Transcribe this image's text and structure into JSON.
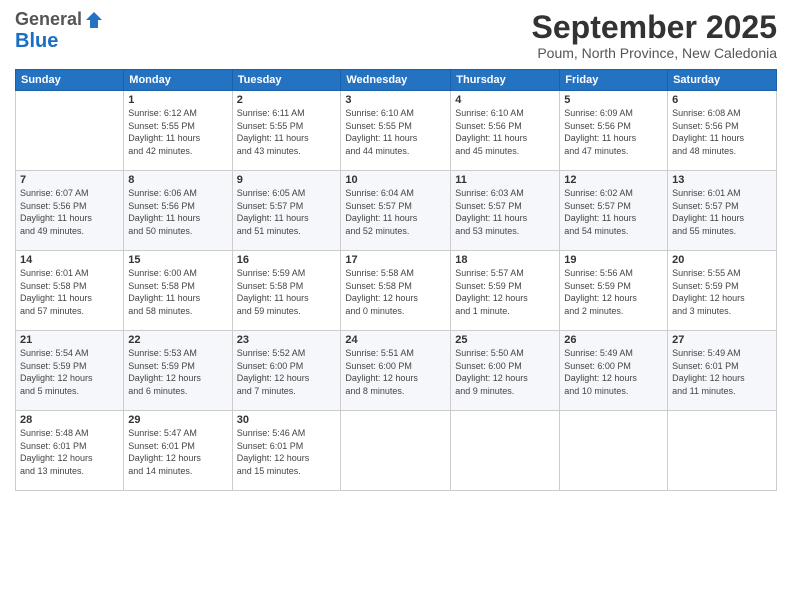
{
  "logo": {
    "general": "General",
    "blue": "Blue"
  },
  "header": {
    "month": "September 2025",
    "location": "Poum, North Province, New Caledonia"
  },
  "weekdays": [
    "Sunday",
    "Monday",
    "Tuesday",
    "Wednesday",
    "Thursday",
    "Friday",
    "Saturday"
  ],
  "weeks": [
    [
      null,
      {
        "day": "1",
        "sunrise": "6:12 AM",
        "sunset": "5:55 PM",
        "daylight": "11 hours and 42 minutes."
      },
      {
        "day": "2",
        "sunrise": "6:11 AM",
        "sunset": "5:55 PM",
        "daylight": "11 hours and 43 minutes."
      },
      {
        "day": "3",
        "sunrise": "6:10 AM",
        "sunset": "5:55 PM",
        "daylight": "11 hours and 44 minutes."
      },
      {
        "day": "4",
        "sunrise": "6:10 AM",
        "sunset": "5:56 PM",
        "daylight": "11 hours and 45 minutes."
      },
      {
        "day": "5",
        "sunrise": "6:09 AM",
        "sunset": "5:56 PM",
        "daylight": "11 hours and 47 minutes."
      },
      {
        "day": "6",
        "sunrise": "6:08 AM",
        "sunset": "5:56 PM",
        "daylight": "11 hours and 48 minutes."
      }
    ],
    [
      {
        "day": "7",
        "sunrise": "6:07 AM",
        "sunset": "5:56 PM",
        "daylight": "11 hours and 49 minutes."
      },
      {
        "day": "8",
        "sunrise": "6:06 AM",
        "sunset": "5:56 PM",
        "daylight": "11 hours and 50 minutes."
      },
      {
        "day": "9",
        "sunrise": "6:05 AM",
        "sunset": "5:57 PM",
        "daylight": "11 hours and 51 minutes."
      },
      {
        "day": "10",
        "sunrise": "6:04 AM",
        "sunset": "5:57 PM",
        "daylight": "11 hours and 52 minutes."
      },
      {
        "day": "11",
        "sunrise": "6:03 AM",
        "sunset": "5:57 PM",
        "daylight": "11 hours and 53 minutes."
      },
      {
        "day": "12",
        "sunrise": "6:02 AM",
        "sunset": "5:57 PM",
        "daylight": "11 hours and 54 minutes."
      },
      {
        "day": "13",
        "sunrise": "6:01 AM",
        "sunset": "5:57 PM",
        "daylight": "11 hours and 55 minutes."
      }
    ],
    [
      {
        "day": "14",
        "sunrise": "6:01 AM",
        "sunset": "5:58 PM",
        "daylight": "11 hours and 57 minutes."
      },
      {
        "day": "15",
        "sunrise": "6:00 AM",
        "sunset": "5:58 PM",
        "daylight": "11 hours and 58 minutes."
      },
      {
        "day": "16",
        "sunrise": "5:59 AM",
        "sunset": "5:58 PM",
        "daylight": "11 hours and 59 minutes."
      },
      {
        "day": "17",
        "sunrise": "5:58 AM",
        "sunset": "5:58 PM",
        "daylight": "12 hours and 0 minutes."
      },
      {
        "day": "18",
        "sunrise": "5:57 AM",
        "sunset": "5:59 PM",
        "daylight": "12 hours and 1 minute."
      },
      {
        "day": "19",
        "sunrise": "5:56 AM",
        "sunset": "5:59 PM",
        "daylight": "12 hours and 2 minutes."
      },
      {
        "day": "20",
        "sunrise": "5:55 AM",
        "sunset": "5:59 PM",
        "daylight": "12 hours and 3 minutes."
      }
    ],
    [
      {
        "day": "21",
        "sunrise": "5:54 AM",
        "sunset": "5:59 PM",
        "daylight": "12 hours and 5 minutes."
      },
      {
        "day": "22",
        "sunrise": "5:53 AM",
        "sunset": "5:59 PM",
        "daylight": "12 hours and 6 minutes."
      },
      {
        "day": "23",
        "sunrise": "5:52 AM",
        "sunset": "6:00 PM",
        "daylight": "12 hours and 7 minutes."
      },
      {
        "day": "24",
        "sunrise": "5:51 AM",
        "sunset": "6:00 PM",
        "daylight": "12 hours and 8 minutes."
      },
      {
        "day": "25",
        "sunrise": "5:50 AM",
        "sunset": "6:00 PM",
        "daylight": "12 hours and 9 minutes."
      },
      {
        "day": "26",
        "sunrise": "5:49 AM",
        "sunset": "6:00 PM",
        "daylight": "12 hours and 10 minutes."
      },
      {
        "day": "27",
        "sunrise": "5:49 AM",
        "sunset": "6:01 PM",
        "daylight": "12 hours and 11 minutes."
      }
    ],
    [
      {
        "day": "28",
        "sunrise": "5:48 AM",
        "sunset": "6:01 PM",
        "daylight": "12 hours and 13 minutes."
      },
      {
        "day": "29",
        "sunrise": "5:47 AM",
        "sunset": "6:01 PM",
        "daylight": "12 hours and 14 minutes."
      },
      {
        "day": "30",
        "sunrise": "5:46 AM",
        "sunset": "6:01 PM",
        "daylight": "12 hours and 15 minutes."
      },
      null,
      null,
      null,
      null
    ]
  ]
}
